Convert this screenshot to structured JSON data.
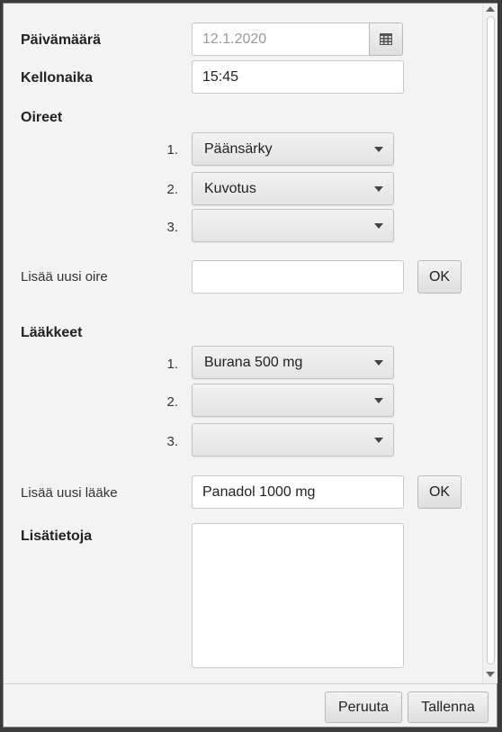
{
  "form": {
    "date_label": "Päivämäärä",
    "date_value": "12.1.2020",
    "time_label": "Kellonaika",
    "time_value": "15:45",
    "symptoms_label": "Oireet",
    "symptoms": [
      {
        "num": "1.",
        "value": "Päänsärky"
      },
      {
        "num": "2.",
        "value": "Kuvotus"
      },
      {
        "num": "3.",
        "value": ""
      }
    ],
    "add_symptom_label": "Lisää uusi oire",
    "add_symptom_value": "",
    "add_symptom_ok": "OK",
    "medicines_label": "Lääkkeet",
    "medicines": [
      {
        "num": "1.",
        "value": "Burana 500 mg"
      },
      {
        "num": "2.",
        "value": ""
      },
      {
        "num": "3.",
        "value": ""
      }
    ],
    "add_medicine_label": "Lisää uusi lääke",
    "add_medicine_value": "Panadol 1000 mg",
    "add_medicine_ok": "OK",
    "notes_label": "Lisätietoja",
    "notes_value": ""
  },
  "footer": {
    "cancel_label": "Peruuta",
    "save_label": "Tallenna"
  },
  "icons": {
    "calendar": "calendar-icon",
    "dropdown": "chevron-down-icon"
  }
}
